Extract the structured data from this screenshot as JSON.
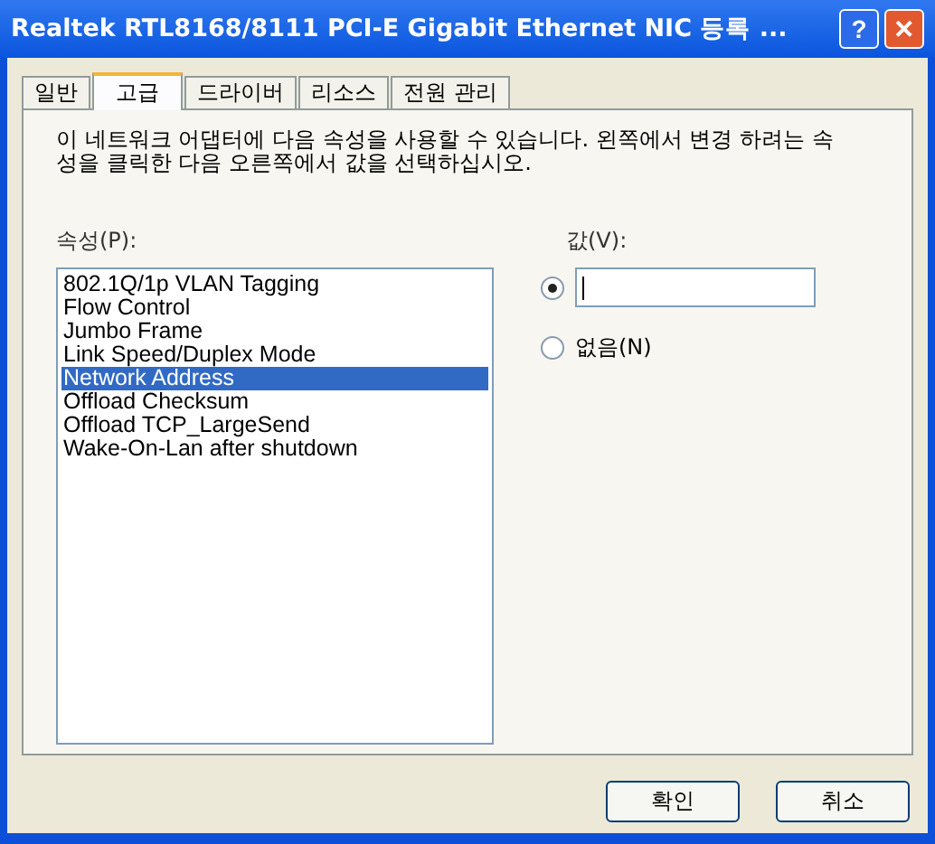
{
  "window": {
    "title": "Realtek RTL8168/8111 PCI-E Gigabit Ethernet NIC 등록 ..."
  },
  "title_buttons": [
    "?",
    "✕"
  ],
  "tabs": [
    {
      "label": "일반",
      "selected": false
    },
    {
      "label": "고급",
      "selected": true
    },
    {
      "label": "드라이버",
      "selected": false
    },
    {
      "label": "리소스",
      "selected": false
    },
    {
      "label": "전원 관리",
      "selected": false
    }
  ],
  "description": "이 네트워크 어댑터에 다음 속성을 사용할 수 있습니다. 왼쪽에서 변경 하려는 속성을 클릭한 다음 오른쪽에서 값을 선택하십시오.",
  "property_label": "속성(P):",
  "properties": [
    {
      "label": "802.1Q/1p VLAN Tagging",
      "selected": false
    },
    {
      "label": "Flow Control",
      "selected": false
    },
    {
      "label": "Jumbo Frame",
      "selected": false
    },
    {
      "label": "Link Speed/Duplex Mode",
      "selected": false
    },
    {
      "label": "Network Address",
      "selected": true
    },
    {
      "label": "Offload Checksum",
      "selected": false
    },
    {
      "label": "Offload TCP_LargeSend",
      "selected": false
    },
    {
      "label": "Wake-On-Lan after shutdown",
      "selected": false
    }
  ],
  "value_label": "값(V):",
  "options": [
    {
      "kind": "field",
      "selected": true
    },
    {
      "kind": "label",
      "label": "없음(N)",
      "selected": false
    }
  ],
  "buttons": [
    "확인",
    "취소"
  ]
}
